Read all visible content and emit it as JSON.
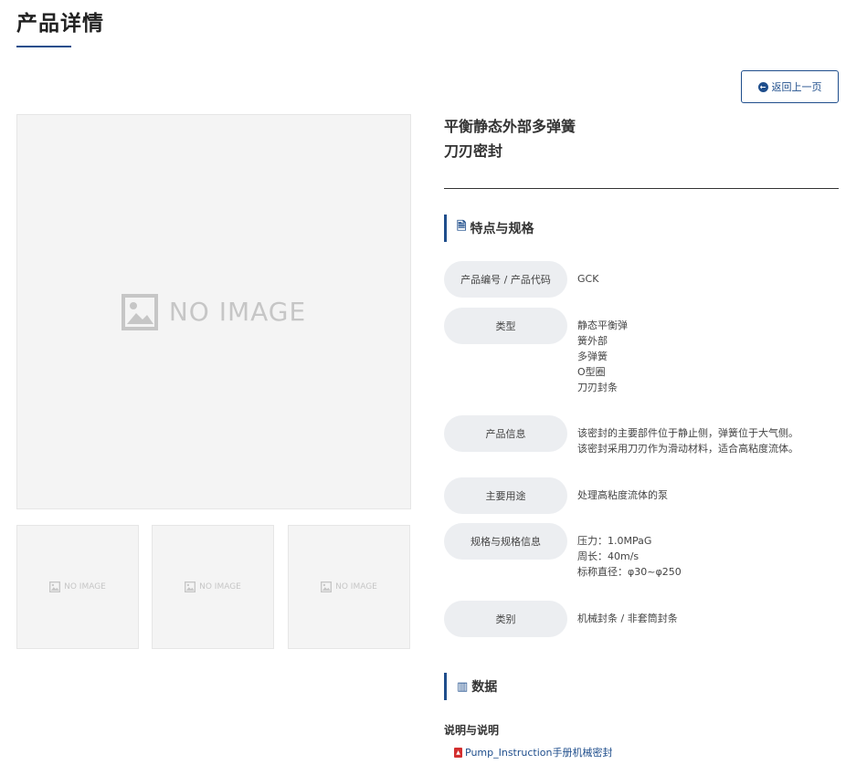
{
  "page": {
    "title": "产品详情"
  },
  "back_button": {
    "label": "返回上一页",
    "icon": "arrow-left-circle-icon"
  },
  "gallery": {
    "placeholder_text": "NO IMAGE",
    "thumb_placeholder_text": "NO IMAGE"
  },
  "product": {
    "name_line1": "平衡静态外部多弹簧",
    "name_line2": "刀刃密封"
  },
  "sections": {
    "specs_title": "特点与规格",
    "data_title": "数据"
  },
  "specs": {
    "code": {
      "label": "产品编号 / 产品代码",
      "lines": [
        "GCK"
      ]
    },
    "type": {
      "label": "类型",
      "lines": [
        "静态平衡弹",
        "簧外部",
        "多弹簧",
        "O型圈",
        "刀刃封条"
      ]
    },
    "info": {
      "label": "产品信息",
      "lines": [
        "该密封的主要部件位于静止侧，弹簧位于大气侧。",
        "该密封采用刀刃作为滑动材料，适合高粘度流体。"
      ]
    },
    "usage": {
      "label": "主要用途",
      "lines": [
        "处理高粘度流体的泵"
      ]
    },
    "specinfo": {
      "label": "规格与规格信息",
      "lines": [
        "压力：1.0MPaG",
        "周长：40m/s",
        "标称直径：φ30~φ250"
      ]
    },
    "category": {
      "label": "类别",
      "lines": [
        "机械封条 / 非套筒封条"
      ]
    }
  },
  "downloads": {
    "title": "说明与说明",
    "link_label": "Pump_Instruction手册机械密封"
  },
  "colors": {
    "accent": "#1f4e8c",
    "pdf": "#d32f2f",
    "label_bg": "#eceef1"
  }
}
